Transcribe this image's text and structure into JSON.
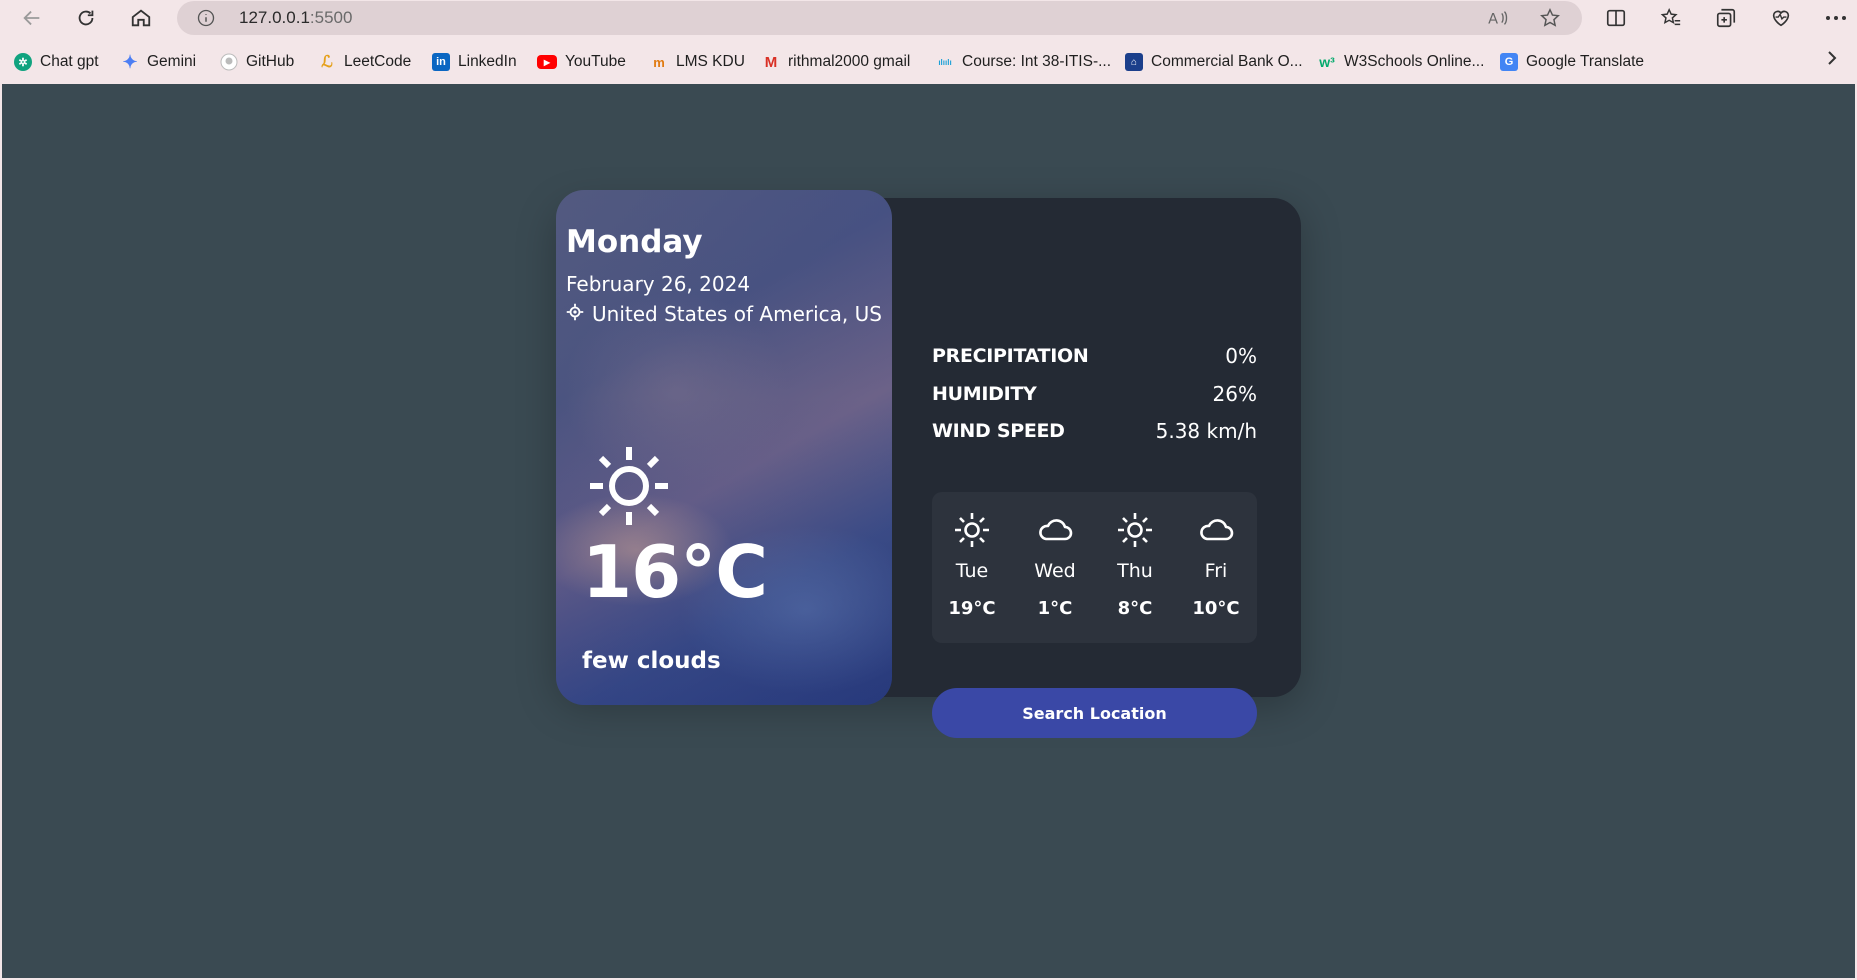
{
  "browser": {
    "url_host": "127.0.0.1",
    "url_port": ":5500",
    "bookmarks": [
      {
        "label": "Chat gpt",
        "icon": "chatgpt-icon"
      },
      {
        "label": "Gemini",
        "icon": "gemini-icon"
      },
      {
        "label": "GitHub",
        "icon": "github-icon"
      },
      {
        "label": "LeetCode",
        "icon": "leetcode-icon"
      },
      {
        "label": "LinkedIn",
        "icon": "linkedin-icon"
      },
      {
        "label": "YouTube",
        "icon": "youtube-icon"
      },
      {
        "label": "LMS KDU",
        "icon": "lms-icon"
      },
      {
        "label": "rithmal2000 gmail",
        "icon": "gmail-icon"
      },
      {
        "label": "Course: Int 38-ITIS-...",
        "icon": "cisco-icon"
      },
      {
        "label": "Commercial Bank O...",
        "icon": "bank-icon"
      },
      {
        "label": "W3Schools Online...",
        "icon": "w3schools-icon"
      },
      {
        "label": "Google Translate",
        "icon": "google-translate-icon"
      }
    ]
  },
  "weather": {
    "day": "Monday",
    "date": "February 26, 2024",
    "location": "United States of America, US",
    "current_icon": "sun-icon",
    "temperature": "16°C",
    "description": "few clouds"
  },
  "stats": [
    {
      "label": "PRECIPITATION",
      "value": "0%"
    },
    {
      "label": "HUMIDITY",
      "value": "26%"
    },
    {
      "label": "WIND SPEED",
      "value": "5.38 km/h"
    }
  ],
  "forecast": [
    {
      "day": "Tue",
      "temp": "19°C",
      "icon": "sun-icon"
    },
    {
      "day": "Wed",
      "temp": "1°C",
      "icon": "cloud-icon"
    },
    {
      "day": "Thu",
      "temp": "8°C",
      "icon": "sun-icon"
    },
    {
      "day": "Fri",
      "temp": "10°C",
      "icon": "cloud-icon"
    }
  ],
  "search_button": "Search Location",
  "colors": {
    "page_bg": "#3a4a52",
    "card_bg": "#242a34",
    "forecast_bg": "#2d333d",
    "button_bg": "#3a48a6"
  }
}
